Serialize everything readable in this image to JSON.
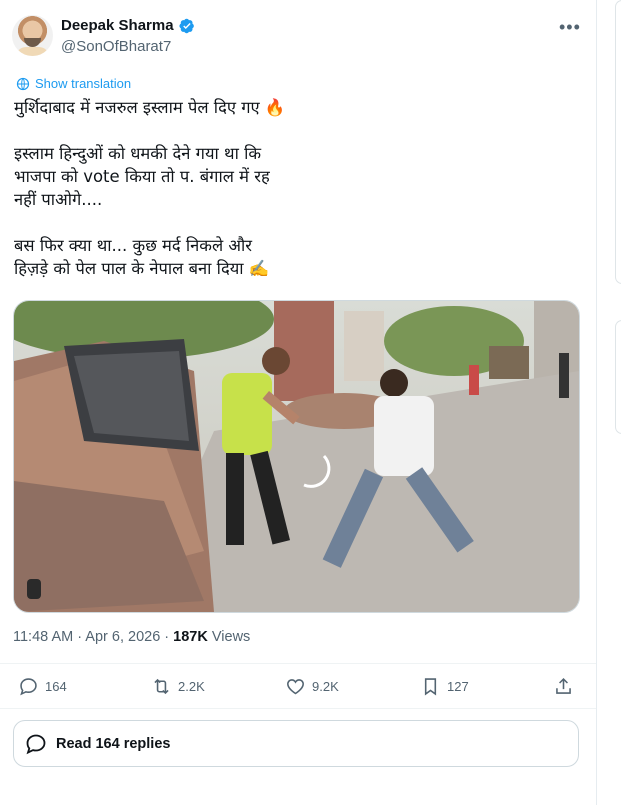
{
  "author": {
    "display_name": "Deepak Sharma",
    "handle": "@SonOfBharat7",
    "verified_icon": "verified-badge-icon",
    "accent": "#1d9bf0"
  },
  "show_translation": "Show translation",
  "tweet_text": "मुर्शिदाबाद में नजरुल इस्लाम पेल दिए गए 🔥\n\nइस्लाम हिन्दुओं को धमकी देने गया था कि\nभाजपा को vote किया तो प. बंगाल में रह\nनहीं पाओगे....\n\nबस फिर क्या था... कुछ मर्द निकले और\nहिज़ड़े को पेल पाल के नेपाल बना दिया ✍️",
  "meta": {
    "time": "11:48 AM",
    "separator": " · ",
    "date": "Apr 6, 2026",
    "views_count": "187K",
    "views_label": " Views"
  },
  "actions": {
    "reply": "164",
    "repost": "2.2K",
    "like": "9.2K",
    "bookmark": "127"
  },
  "read_replies": "Read 164 replies",
  "more_icon": "more-horizontal-icon"
}
